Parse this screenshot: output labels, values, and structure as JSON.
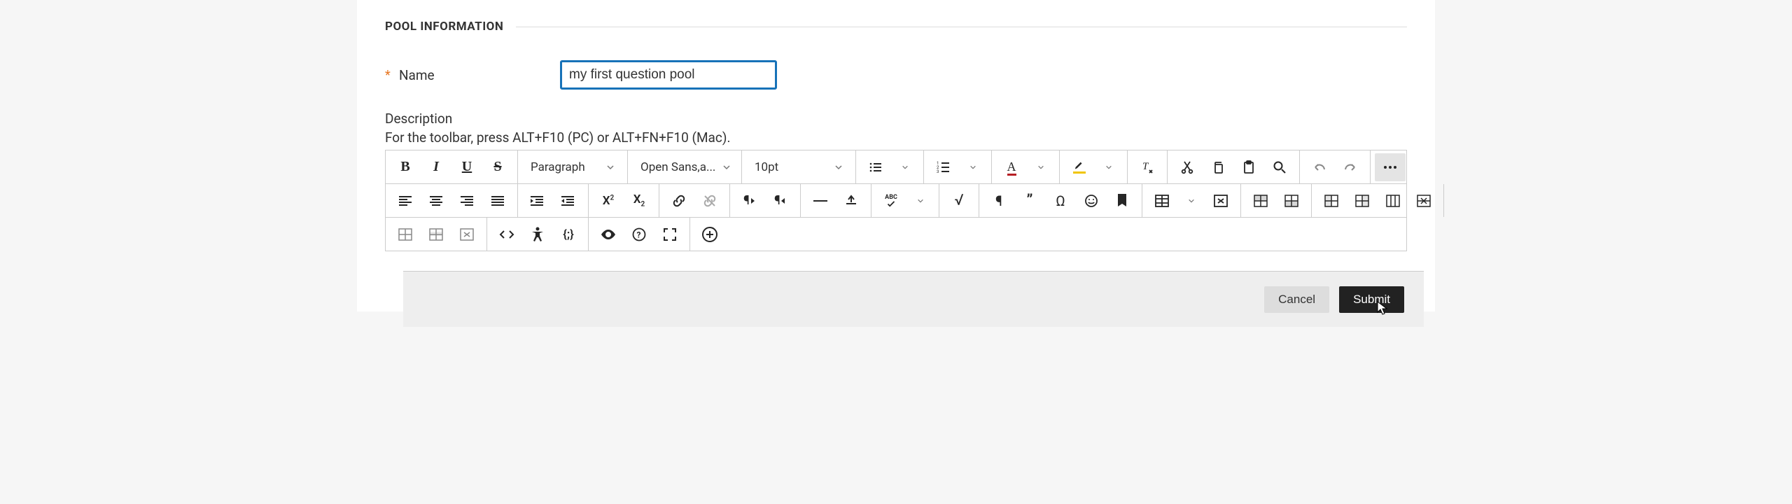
{
  "section": {
    "title": "POOL INFORMATION"
  },
  "fields": {
    "name_label": "Name",
    "name_value": "my first question pool",
    "desc_label": "Description",
    "hint": "For the toolbar, press ALT+F10 (PC) or ALT+FN+F10 (Mac)."
  },
  "toolbar": {
    "block_format": "Paragraph",
    "font_family": "Open Sans,a...",
    "font_size": "10pt",
    "spellcheck_label": "ABC"
  },
  "footer": {
    "cancel": "Cancel",
    "submit": "Submit"
  }
}
